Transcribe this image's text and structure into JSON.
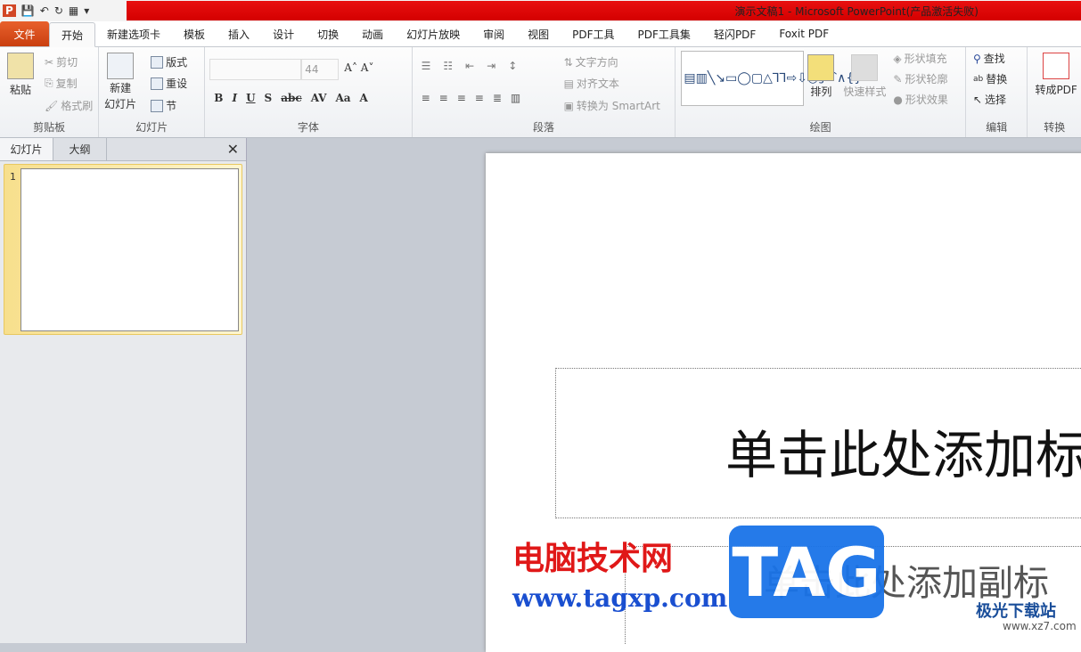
{
  "title": "演示文稿1 - Microsoft PowerPoint(产品激活失败)",
  "tabs": [
    "文件",
    "开始",
    "新建选项卡",
    "模板",
    "插入",
    "设计",
    "切换",
    "动画",
    "幻灯片放映",
    "审阅",
    "视图",
    "PDF工具",
    "PDF工具集",
    "轻闪PDF",
    "Foxit PDF"
  ],
  "ribbon": {
    "clipboard": {
      "label": "剪贴板",
      "paste": "粘贴",
      "cut": "剪切",
      "copy": "复制",
      "format_painter": "格式刷"
    },
    "slides": {
      "label": "幻灯片",
      "new_slide_1": "新建",
      "new_slide_2": "幻灯片",
      "layout": "版式",
      "reset": "重设",
      "section": "节"
    },
    "font": {
      "label": "字体",
      "font_name": "",
      "font_size": "44"
    },
    "paragraph": {
      "label": "段落",
      "text_direction": "文字方向",
      "align_text": "对齐文本",
      "smartart": "转换为 SmartArt"
    },
    "drawing": {
      "label": "绘图",
      "arrange": "排列",
      "quick_styles": "快速样式",
      "shape_fill": "形状填充",
      "shape_outline": "形状轮廓",
      "shape_effects": "形状效果"
    },
    "editing": {
      "label": "编辑",
      "find": "查找",
      "replace": "替换",
      "select": "选择"
    },
    "convert": {
      "label": "转换",
      "to_pdf": "转成PDF"
    }
  },
  "panel": {
    "tab_slides": "幻灯片",
    "tab_outline": "大纲",
    "slide_number": "1"
  },
  "slide": {
    "title_placeholder": "单击此处添加标",
    "subtitle_placeholder": "单击此处添加副标"
  },
  "watermarks": {
    "site_name": "电脑技术网",
    "site_url": "www.tagxp.com",
    "tag": "TAG",
    "site2_name": "极光下载站",
    "site2_url": "www.xz7.com"
  }
}
